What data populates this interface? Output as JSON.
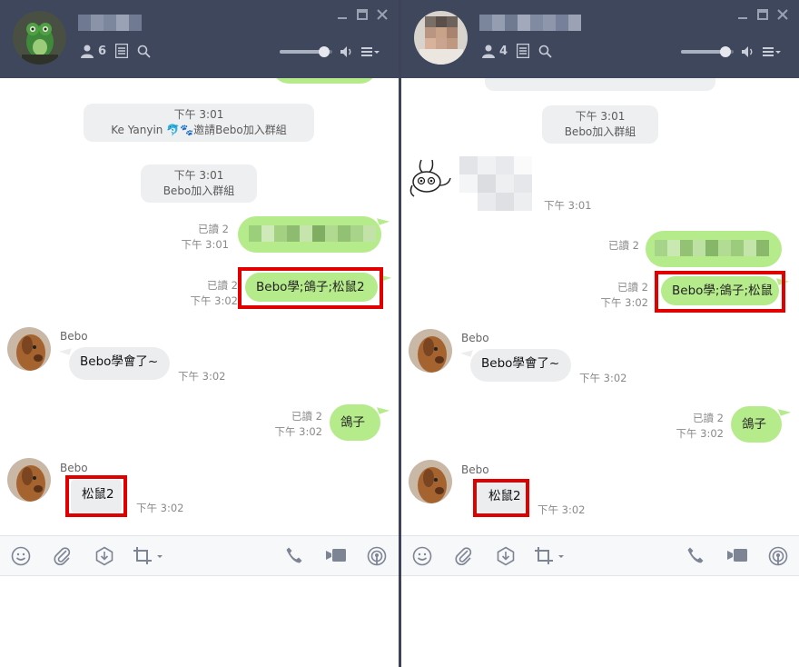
{
  "left": {
    "member_count": "6",
    "system_messages": [
      {
        "time": "下午 3:01",
        "text": "Ke Yanyin",
        "suffix": "邀請Bebo加入群組"
      },
      {
        "time": "下午 3:01",
        "text": "Bebo加入群組"
      }
    ],
    "messages": [
      {
        "read": "已讀 2",
        "time": "下午 3:01"
      },
      {
        "read": "已讀 2",
        "time": "下午 3:02",
        "text": "Bebo學;鴿子;松鼠2"
      },
      {
        "sender": "Bebo",
        "text": "Bebo學會了~",
        "time": "下午 3:02"
      },
      {
        "read": "已讀 2",
        "time": "下午 3:02",
        "text": "鴿子"
      },
      {
        "sender": "Bebo",
        "text": "松鼠2",
        "time": "下午 3:02"
      }
    ]
  },
  "right": {
    "member_count": "4",
    "system_messages": [
      {
        "time": "下午 3:01",
        "text": "Bebo加入群組"
      }
    ],
    "messages": [
      {
        "time": "下午 3:01"
      },
      {
        "read": "已讀 2"
      },
      {
        "read": "已讀 2",
        "time": "下午 3:02",
        "text": "Bebo學;鴿子;松鼠"
      },
      {
        "sender": "Bebo",
        "text": "Bebo學會了~",
        "time": "下午 3:02"
      },
      {
        "read": "已讀 2",
        "time": "下午 3:02",
        "text": "鴿子"
      },
      {
        "sender": "Bebo",
        "text": "松鼠2",
        "time": "下午 3:02"
      }
    ]
  },
  "icons": {
    "toolbar": [
      "emoji-icon",
      "attachment-icon",
      "download-icon",
      "crop-screenshot-icon",
      "phone-call-icon",
      "video-call-icon",
      "live-broadcast-icon"
    ],
    "header": [
      "members-icon",
      "notes-icon",
      "search-icon",
      "volume-icon",
      "menu-icon",
      "minimize-icon",
      "maximize-icon",
      "close-icon"
    ]
  },
  "colors": {
    "header_bg": "#3e475c",
    "my_bubble": "#b6eb8c",
    "other_bubble": "#ecedef",
    "highlight": "#e00000"
  },
  "volume_level": 0.85
}
